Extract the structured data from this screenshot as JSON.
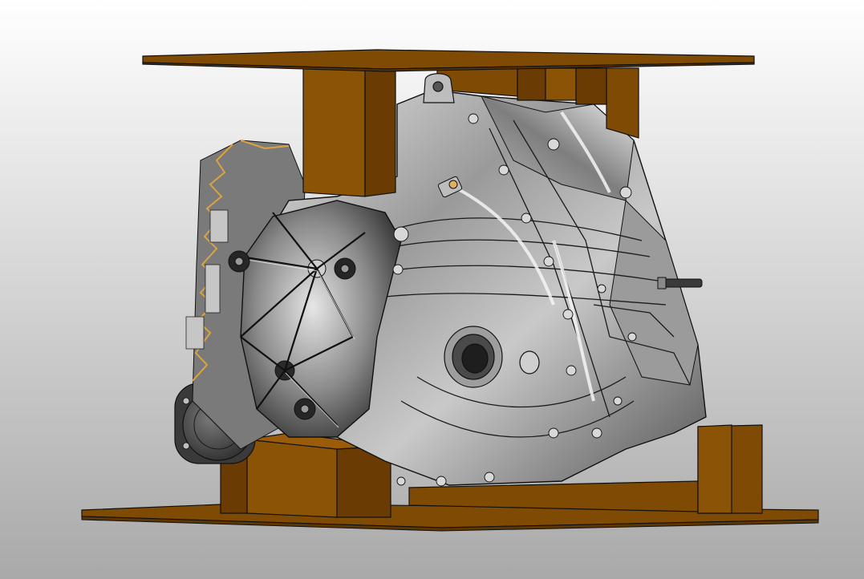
{
  "scene": {
    "background_top": "#ffffff",
    "background_bottom": "#a9a9a9",
    "fixture_color": "#7f4a04",
    "fixture_dark": "#5e3603",
    "fixture_light": "#9a5c0b",
    "housing_light": "#d6d6d6",
    "housing_mid": "#8c8c8c",
    "housing_dark": "#3a3a3a",
    "edge_color": "#111111",
    "highlight_color": "#e0b060"
  },
  "objects": [
    "top-fixture-plate",
    "bottom-fixture-plate",
    "support-blocks",
    "transmission-housing",
    "bell-housing-front",
    "output-shaft-seal",
    "shift-lever-pin",
    "actuator-motor"
  ]
}
